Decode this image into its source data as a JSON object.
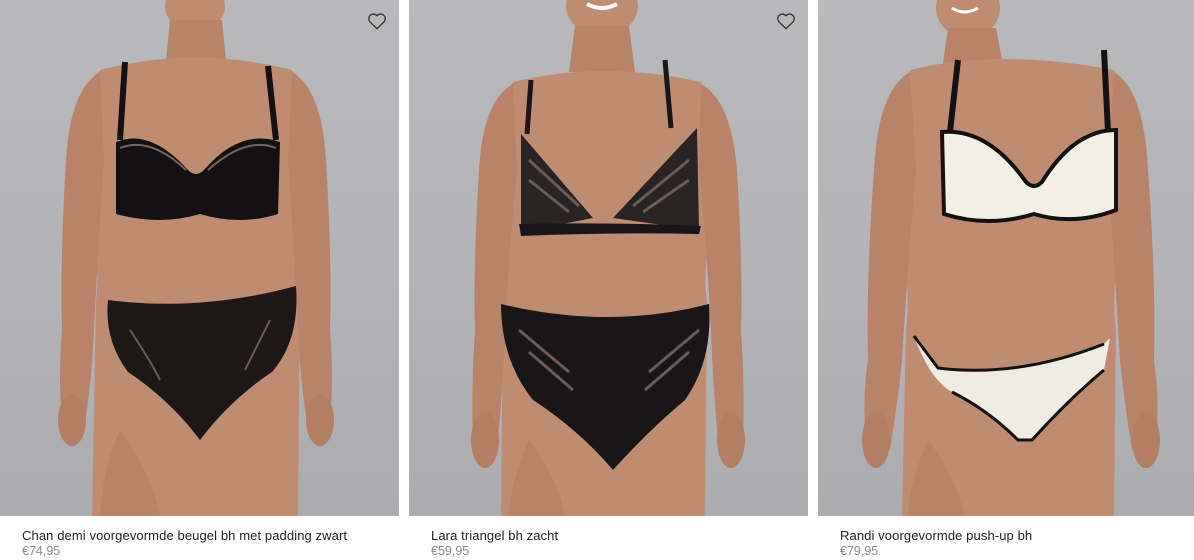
{
  "products": [
    {
      "name": "Chan demi voorgevormde beugel bh met padding zwart",
      "price": "€74,95",
      "image_desc": "model-black-lace-demi-bra",
      "bra_color": "#151112",
      "brief_color": "#1e1718",
      "trim_color": "#0d0b0b",
      "wishlist_icon": "heart-outline-icon"
    },
    {
      "name": "Lara triangel bh zacht",
      "price": "€59,95",
      "image_desc": "model-black-mesh-triangle-bra",
      "bra_color": "#1a1617",
      "brief_color": "#1a1617",
      "trim_color": "#0d0b0b",
      "wishlist_icon": "heart-outline-icon"
    },
    {
      "name": "Randi voorgevormde push-up bh",
      "price": "€79,95",
      "image_desc": "model-cream-push-up-bra",
      "bra_color": "#f4efe4",
      "brief_color": "#f1ebe0",
      "trim_color": "#141112",
      "wishlist_icon": "heart-outline-icon"
    }
  ],
  "colors": {
    "skin": "#c08c71",
    "skin_shade": "#a8735a",
    "photo_bg": "#b6b6b8"
  }
}
